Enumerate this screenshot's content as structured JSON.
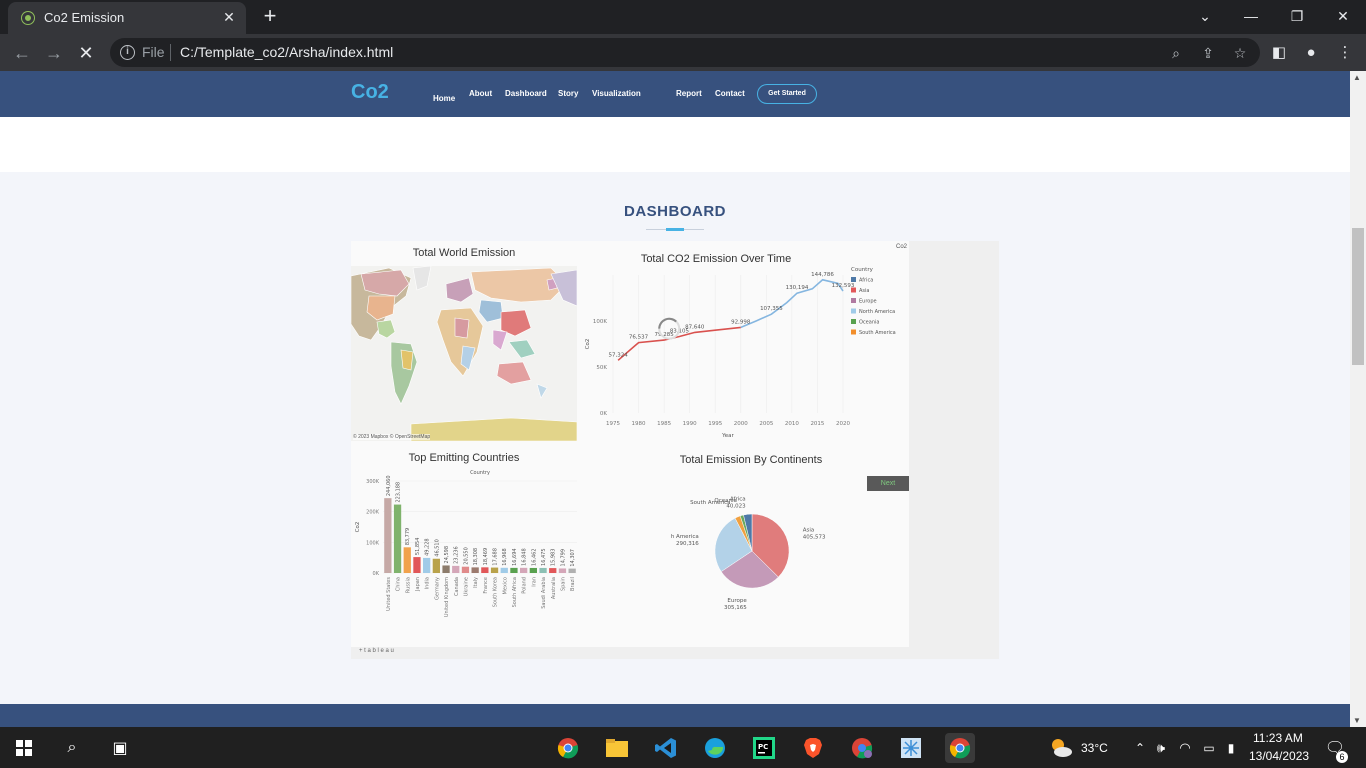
{
  "browser": {
    "tab_title": "Co2 Emission",
    "close_glyph": "✕",
    "new_tab_glyph": "+",
    "scheme": "File",
    "url": "C:/Template_co2/Arsha/index.html"
  },
  "site": {
    "logo": "Co2",
    "nav": [
      "Home",
      "About",
      "Dashboard",
      "Story",
      "Visualization",
      "Report",
      "Contact"
    ],
    "cta": "Get Started",
    "section_title": "DASHBOARD"
  },
  "dashboard": {
    "map_title": "Total World Emission",
    "map_attribution": "© 2023 Mapbox © OpenStreetMap",
    "line_title": "Total CO2 Emission Over Time",
    "corner_label": "Co2",
    "bar_title": "Top Emitting Countries",
    "pie_title": "Total Emission By Continents",
    "next_button": "Next",
    "tableau_brand": "+ t a b l e a u"
  },
  "chart_data": [
    {
      "type": "line",
      "title": "Total CO2 Emission Over Time",
      "xlabel": "Year",
      "ylabel": "Co2",
      "x_ticks": [
        "1975",
        "1980",
        "1985",
        "1990",
        "1995",
        "2000",
        "2005",
        "2010",
        "2015",
        "2020"
      ],
      "y_ticks": [
        "0K",
        "50K",
        "100K"
      ],
      "xlim": [
        1975,
        2020
      ],
      "ylim": [
        0,
        150000
      ],
      "legend_title": "Country",
      "legend": [
        {
          "name": "Africa",
          "color": "#4e79a7"
        },
        {
          "name": "Asia",
          "color": "#e15759"
        },
        {
          "name": "Europe",
          "color": "#b07aa1"
        },
        {
          "name": "North America",
          "color": "#a0cbe8"
        },
        {
          "name": "Oceania",
          "color": "#59a14f"
        },
        {
          "name": "South America",
          "color": "#f28e2b"
        }
      ],
      "series": [
        {
          "name": "Asia",
          "color": "#d9514e",
          "points": [
            [
              1976,
              57324
            ],
            [
              1980,
              76537
            ],
            [
              1985,
              79285
            ],
            [
              1988,
              83105
            ],
            [
              1991,
              87640
            ],
            [
              1995,
              90000
            ],
            [
              2000,
              92998
            ]
          ]
        },
        {
          "name": "North America",
          "color": "#85b6e0",
          "points": [
            [
              2000,
              92998
            ],
            [
              2003,
              100000
            ],
            [
              2006,
              107355
            ],
            [
              2009,
              120000
            ],
            [
              2011,
              130194
            ],
            [
              2014,
              135000
            ],
            [
              2016,
              144786
            ],
            [
              2019,
              141000
            ],
            [
              2020,
              132593
            ]
          ]
        }
      ],
      "data_labels": [
        {
          "x": 1976,
          "y": 57324,
          "text": "57,324"
        },
        {
          "x": 1980,
          "y": 76537,
          "text": "76,537"
        },
        {
          "x": 1985,
          "y": 79285,
          "text": "79,285"
        },
        {
          "x": 1988,
          "y": 83105,
          "text": "83,105"
        },
        {
          "x": 1991,
          "y": 87640,
          "text": "87,640"
        },
        {
          "x": 2000,
          "y": 92998,
          "text": "92,998"
        },
        {
          "x": 2006,
          "y": 107355,
          "text": "107,355"
        },
        {
          "x": 2011,
          "y": 130194,
          "text": "130,194"
        },
        {
          "x": 2016,
          "y": 144786,
          "text": "144,786"
        },
        {
          "x": 2020,
          "y": 132593,
          "text": "132,593"
        }
      ]
    },
    {
      "type": "bar",
      "title": "Top Emitting Countries",
      "xlabel": "Country",
      "ylabel": "Co2",
      "y_ticks": [
        "0K",
        "100K",
        "200K",
        "300K"
      ],
      "ylim": [
        0,
        300000
      ],
      "categories": [
        "United States",
        "China",
        "Russia",
        "Japan",
        "India",
        "Germany",
        "United Kingdom",
        "Canada",
        "Ukraine",
        "Italy",
        "France",
        "South Korea",
        "Mexico",
        "South Africa",
        "Poland",
        "Iran",
        "Saudi Arabia",
        "Australia",
        "Spain",
        "Brazil"
      ],
      "values": [
        244060,
        223188,
        83779,
        51854,
        49228,
        46510,
        24598,
        23236,
        20550,
        18308,
        18469,
        17688,
        16968,
        16694,
        16848,
        16462,
        16475,
        15983,
        14799,
        14307
      ],
      "labels": [
        "244,060",
        "223,188",
        "83,779",
        "51,854",
        "49,228",
        "46,510",
        "24,598",
        "23,236",
        "20,550",
        "18,308",
        "18,469",
        "17,688",
        "16,968",
        "16,694",
        "16,848",
        "16,462",
        "16,475",
        "15,983",
        "14,799",
        "14,307"
      ],
      "colors": [
        "#c6a9a6",
        "#7fb36c",
        "#f1a24c",
        "#e15759",
        "#a0cbe8",
        "#b9a24a",
        "#8c7b6b",
        "#d4a6b8",
        "#e08a8a",
        "#9c7a6e",
        "#e15759",
        "#b9a24a",
        "#a0cbe8",
        "#59a14f",
        "#d4a6b8",
        "#59a14f",
        "#8cc0b4",
        "#e15759",
        "#d4a6b8",
        "#b0b0b0"
      ]
    },
    {
      "type": "pie",
      "title": "Total Emission By Continents",
      "slices": [
        {
          "name": "Asia",
          "value": 405573,
          "label": "405,573",
          "color": "#e07c7c"
        },
        {
          "name": "Europe",
          "value": 305165,
          "label": "305,165",
          "color": "#c49ab8"
        },
        {
          "name": "North America",
          "value": 290316,
          "label": "290,316",
          "color": "#b3d2e8"
        },
        {
          "name": "South America",
          "value": 26000,
          "label": "",
          "color": "#f0a040"
        },
        {
          "name": "Oceania",
          "value": 16000,
          "label": "",
          "color": "#6aa85f"
        },
        {
          "name": "Africa",
          "value": 40023,
          "label": "40,023",
          "color": "#4e79a7"
        }
      ]
    }
  ],
  "taskbar": {
    "temperature": "33°C",
    "time": "11:23 AM",
    "date": "13/04/2023",
    "notifications": "6"
  }
}
